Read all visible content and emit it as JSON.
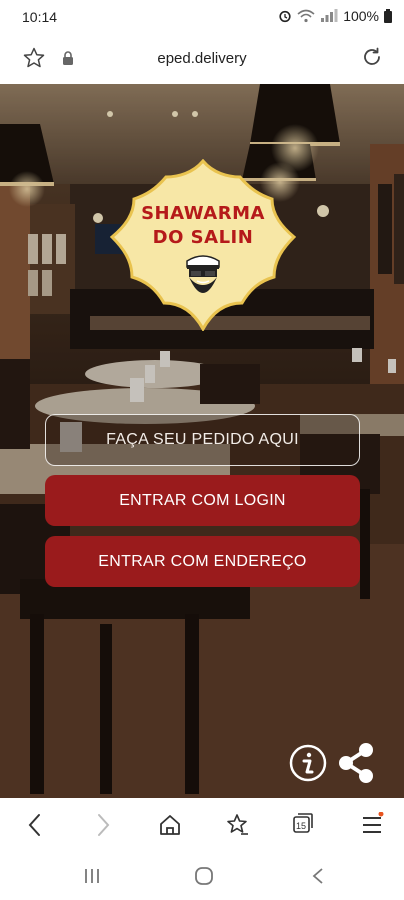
{
  "status_bar": {
    "time": "10:14",
    "battery": "100%"
  },
  "browser": {
    "url": "eped.delivery"
  },
  "logo": {
    "line1": "SHAWARMA",
    "line2": "DO SALIN"
  },
  "actions": {
    "order_label": "FAÇA SEU PEDIDO AQUI",
    "login_label": "ENTRAR COM LOGIN",
    "address_label": "ENTRAR COM ENDEREÇO"
  },
  "toolbar": {
    "tab_count": "15"
  },
  "colors": {
    "brand_red": "#9a1b1c",
    "logo_badge": "#f7e7a6",
    "logo_border": "#e9c34f"
  }
}
